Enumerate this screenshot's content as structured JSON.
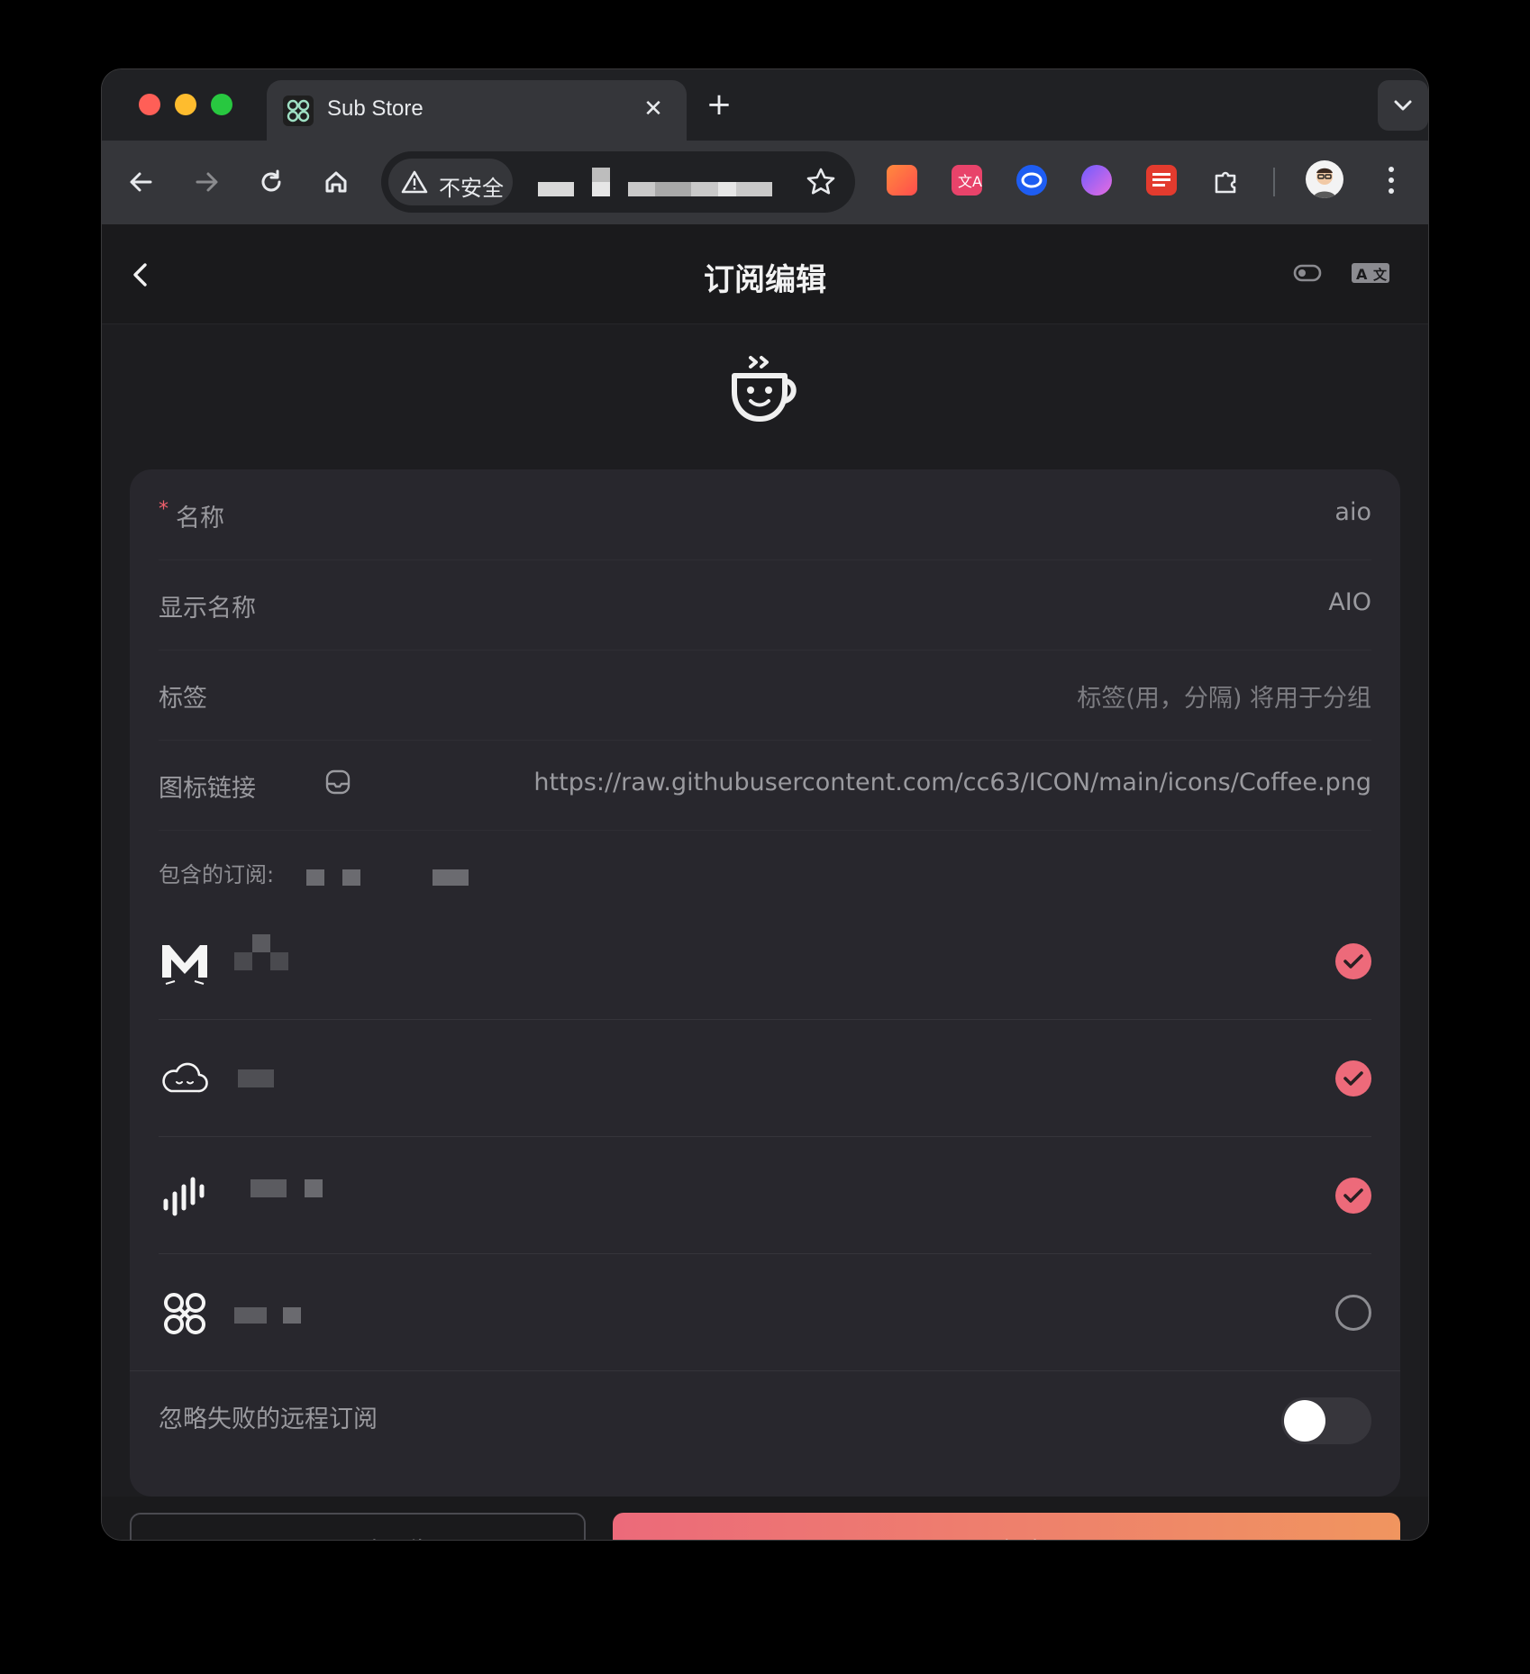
{
  "browser": {
    "tab_title": "Sub Store",
    "security_label": "不安全",
    "colors": {
      "red": "#ff5f57",
      "yellow": "#febc2e",
      "green": "#28c840"
    },
    "extensions": [
      "red-orange-ext-icon",
      "translate-ext-icon",
      "blue-ring-ext-icon",
      "purple-shell-ext-icon",
      "red-list-ext-icon",
      "puzzle-extensions-icon"
    ]
  },
  "header": {
    "title": "订阅编辑"
  },
  "form": {
    "name_label": "名称",
    "name_value": "aio",
    "display_name_label": "显示名称",
    "display_name_value": "AIO",
    "tags_label": "标签",
    "tags_placeholder": "标签(用，分隔) 将用于分组",
    "icon_label": "图标链接",
    "icon_url": "https://raw.githubusercontent.com/cc63/ICON/main/icons/Coffee.png",
    "included_label": "包含的订阅:",
    "subscriptions": [
      {
        "icon": "cat-m-icon",
        "checked": true
      },
      {
        "icon": "cloud-icon",
        "checked": true
      },
      {
        "icon": "sound-bars-icon",
        "checked": true
      },
      {
        "icon": "knot-icon",
        "checked": false
      }
    ],
    "ignore_failed_label": "忽略失败的远程订阅",
    "ignore_failed_on": false
  },
  "footer": {
    "preview_label": "即时预览",
    "save_label": "保存",
    "accent_colors": [
      "#ec6a7a",
      "#f0955f"
    ]
  }
}
